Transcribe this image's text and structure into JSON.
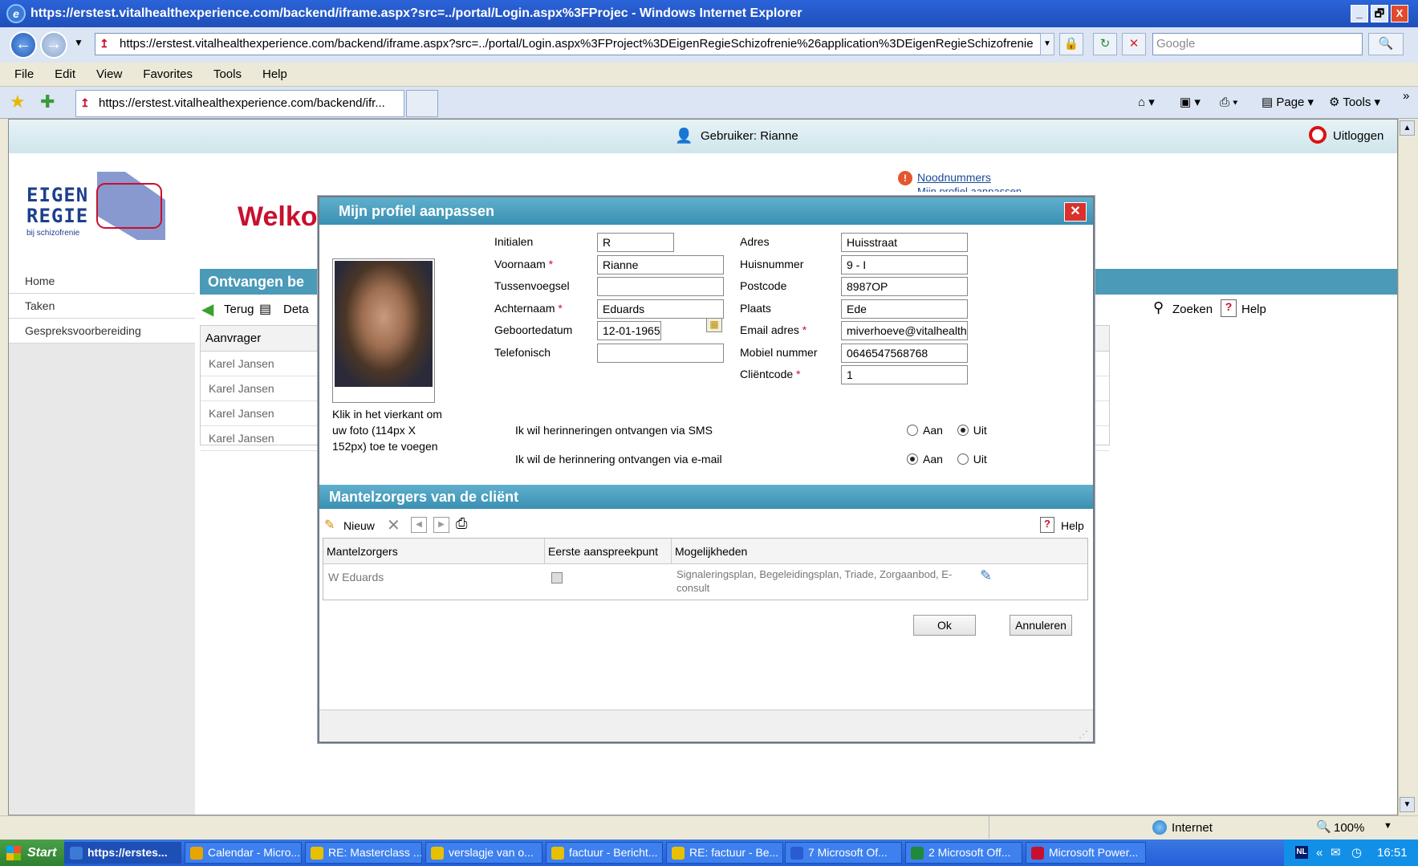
{
  "window": {
    "title": "https://erstest.vitalhealthexperience.com/backend/iframe.aspx?src=../portal/Login.aspx%3FProjec - Windows Internet Explorer",
    "buttons": [
      "_",
      "🗗",
      "X"
    ]
  },
  "address": {
    "url": "https://erstest.vitalhealthexperience.com/backend/iframe.aspx?src=../portal/Login.aspx%3FProject%3DEigenRegieSchizofrenie%26application%3DEigenRegieSchizofrenie",
    "search_placeholder": "Google"
  },
  "menu": [
    "File",
    "Edit",
    "View",
    "Favorites",
    "Tools",
    "Help"
  ],
  "favorites": {
    "tab": "https://erstest.vitalhealthexperience.com/backend/ifr...",
    "page_label": "Page",
    "tools_label": "Tools"
  },
  "app": {
    "user_label": "Gebruiker: Rianne",
    "logout_label": "Uitloggen",
    "logo": {
      "line1": "EIGEN",
      "line2": "REGIE",
      "line3": "bij schizofrenie"
    },
    "welcome": "Welko",
    "emergency_link": "Noodnummers",
    "profile_link": "Mijn profiel aanpassen",
    "nav": [
      "Home",
      "Taken",
      "Gespreksvoorbereiding"
    ],
    "section_title": "Ontvangen be",
    "toolbar": {
      "back": "Terug",
      "detail": "Deta",
      "search": "Zoeken",
      "help": "Help"
    },
    "grid": {
      "header": "Aanvrager",
      "rows": [
        "Karel Jansen",
        "Karel Jansen",
        "Karel Jansen",
        "Karel Jansen"
      ]
    }
  },
  "dialog": {
    "title": "Mijn profiel aanpassen",
    "photo_hint": "Klik in het vierkant om uw foto (114px X 152px) toe te voegen",
    "left_fields": [
      {
        "label": "Initialen",
        "required": false,
        "value": "R"
      },
      {
        "label": "Voornaam",
        "required": true,
        "value": "Rianne"
      },
      {
        "label": "Tussenvoegsel",
        "required": false,
        "value": ""
      },
      {
        "label": "Achternaam",
        "required": true,
        "value": "Eduards"
      },
      {
        "label": "Geboortedatum",
        "required": false,
        "value": "12-01-1965"
      },
      {
        "label": "Telefonisch",
        "required": false,
        "value": ""
      }
    ],
    "right_fields": [
      {
        "label": "Adres",
        "required": false,
        "value": "Huisstraat"
      },
      {
        "label": "Huisnummer",
        "required": false,
        "value": "9 - I"
      },
      {
        "label": "Postcode",
        "required": false,
        "value": "8987OP"
      },
      {
        "label": "Plaats",
        "required": false,
        "value": "Ede"
      },
      {
        "label": "Email adres",
        "required": true,
        "value": "miverhoeve@vitalhealthsc"
      },
      {
        "label": "Mobiel nummer",
        "required": false,
        "value": "0646547568768"
      },
      {
        "label": "Cliëntcode",
        "required": true,
        "value": "1"
      }
    ],
    "sms_label": "Ik wil herinneringen ontvangen via SMS",
    "email_label": "Ik wil de herinnering ontvangen via e-mail",
    "aan": "Aan",
    "uit": "Uit",
    "sms_choice": "Uit",
    "email_choice": "Aan",
    "mz_title": "Mantelzorgers van de cliënt",
    "mz_new": "Nieuw",
    "mz_help": "Help",
    "mz_columns": [
      "Mantelzorgers",
      "Eerste aanspreekpunt",
      "Mogelijkheden"
    ],
    "mz_rows": [
      {
        "name": "W Eduards",
        "first_contact": false,
        "options": "Signaleringsplan, Begeleidingsplan, Triade, Zorgaanbod, E-consult"
      }
    ],
    "ok": "Ok",
    "cancel": "Annuleren"
  },
  "status": {
    "zone": "Internet",
    "zoom": "100%"
  },
  "taskbar": {
    "start": "Start",
    "tasks": [
      "https://erstes...",
      "Calendar - Micro...",
      "RE: Masterclass ...",
      "verslagje van o...",
      "factuur - Bericht...",
      "RE: factuur - Be...",
      "7 Microsoft Of...",
      "2 Microsoft Off...",
      "Microsoft Power..."
    ],
    "lang": "NL",
    "time": "16:51"
  }
}
